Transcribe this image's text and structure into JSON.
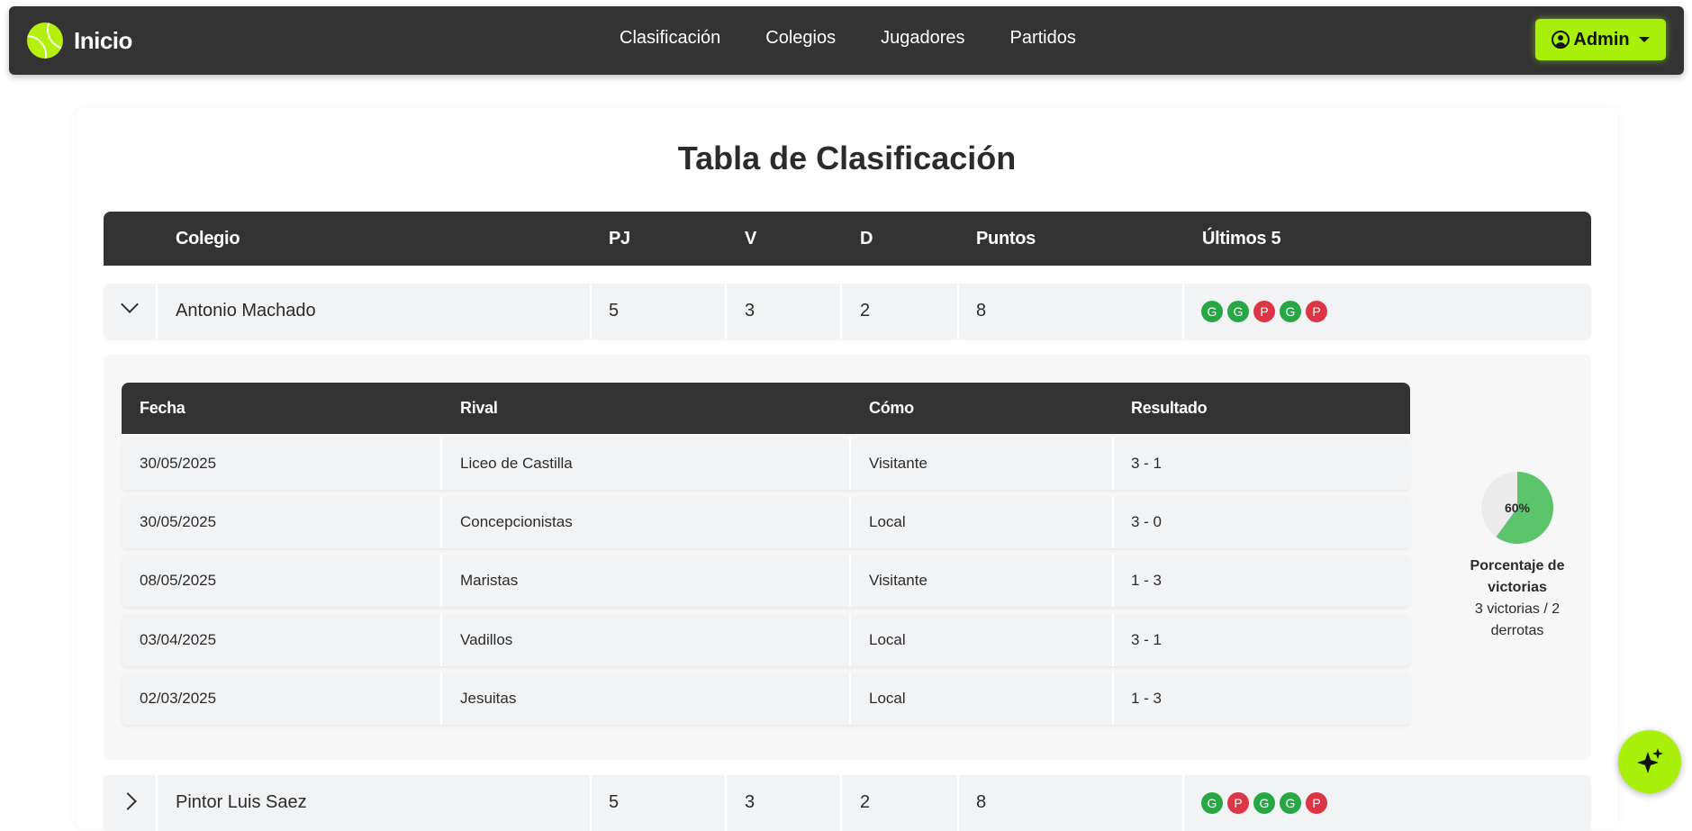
{
  "navbar": {
    "brand": "Inicio",
    "links": [
      "Clasificación",
      "Colegios",
      "Jugadores",
      "Partidos"
    ],
    "admin_label": "Admin"
  },
  "page": {
    "title": "Tabla de Clasificación"
  },
  "standings": {
    "headers": [
      "Colegio",
      "PJ",
      "V",
      "D",
      "Puntos",
      "Últimos 5"
    ],
    "rows": [
      {
        "school": "Antonio Machado",
        "pj": "5",
        "v": "3",
        "d": "2",
        "puntos": "8",
        "last5": [
          "G",
          "G",
          "P",
          "G",
          "P"
        ],
        "expanded": true
      },
      {
        "school": "Pintor Luis Saez",
        "pj": "5",
        "v": "3",
        "d": "2",
        "puntos": "8",
        "last5": [
          "G",
          "P",
          "G",
          "G",
          "P"
        ],
        "expanded": false
      }
    ]
  },
  "matches": {
    "headers": [
      "Fecha",
      "Rival",
      "Cómo",
      "Resultado"
    ],
    "rows": [
      {
        "fecha": "30/05/2025",
        "rival": "Liceo de Castilla",
        "como": "Visitante",
        "resultado": "3 - 1"
      },
      {
        "fecha": "30/05/2025",
        "rival": "Concepcionistas",
        "como": "Local",
        "resultado": "3 - 0"
      },
      {
        "fecha": "08/05/2025",
        "rival": "Maristas",
        "como": "Visitante",
        "resultado": "1 - 3"
      },
      {
        "fecha": "03/04/2025",
        "rival": "Vadillos",
        "como": "Local",
        "resultado": "3 - 1"
      },
      {
        "fecha": "02/03/2025",
        "rival": "Jesuitas",
        "como": "Local",
        "resultado": "1 - 3"
      }
    ]
  },
  "win_stats": {
    "percent_label": "60%",
    "win_fraction": 0.6,
    "title": "Porcentaje de victorias",
    "summary": "3 victorias / 2 derrotas"
  },
  "colors": {
    "win": "#28a745",
    "loss": "#dc3545",
    "pie_win": "#5cc46a",
    "pie_rest": "#ebebeb",
    "accent": "#a8f00a"
  },
  "icons": {
    "brand": "tennis-ball-icon",
    "admin": "user-circle-icon",
    "fab": "sparkles-icon"
  }
}
